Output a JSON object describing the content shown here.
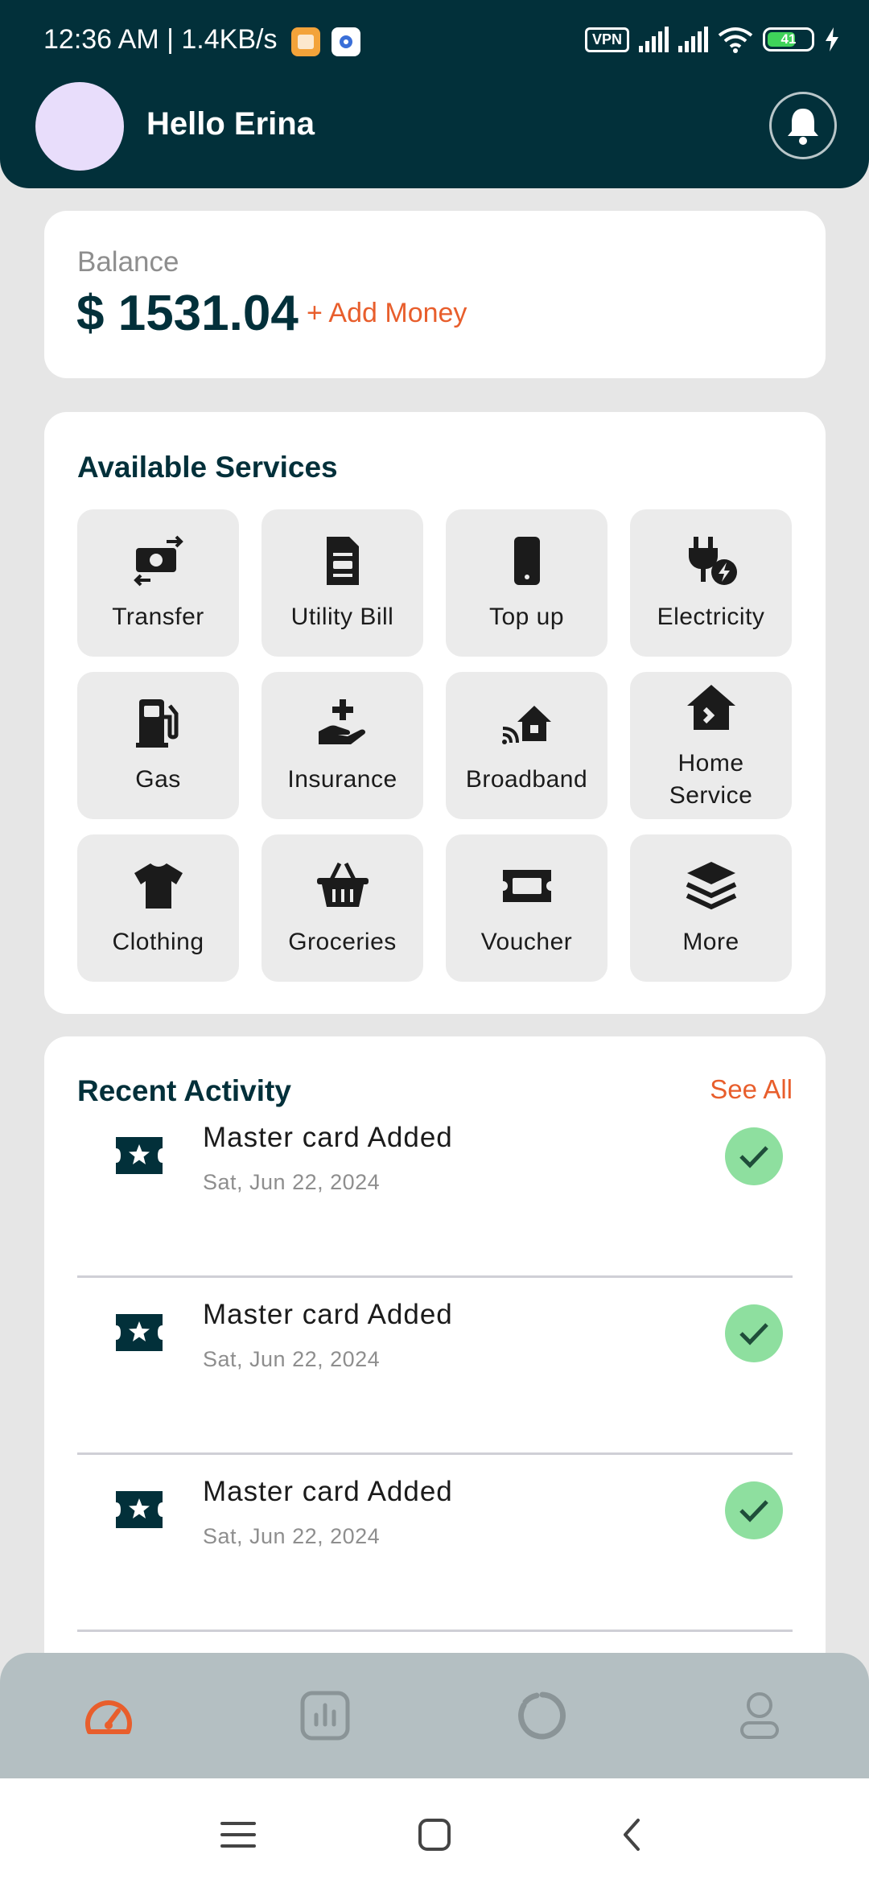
{
  "status_bar": {
    "time": "12:36 AM | 1.4KB/s",
    "vpn": "VPN",
    "battery": "41"
  },
  "header": {
    "greeting": "Hello Erina"
  },
  "balance": {
    "label": "Balance",
    "amount": "$ 1531.04",
    "add_money": "+ Add Money"
  },
  "services": {
    "title": "Available Services",
    "items": [
      {
        "label": "Transfer",
        "icon": "money-transfer-icon"
      },
      {
        "label": "Utility Bill",
        "icon": "bill-icon"
      },
      {
        "label": "Top up",
        "icon": "phone-icon"
      },
      {
        "label": "Electricity",
        "icon": "plug-bolt-icon"
      },
      {
        "label": "Gas",
        "icon": "gas-pump-icon"
      },
      {
        "label": "Insurance",
        "icon": "hand-plus-icon"
      },
      {
        "label": "Broadband",
        "icon": "house-signal-icon"
      },
      {
        "label": "Home Service",
        "icon": "home-icon"
      },
      {
        "label": "Clothing",
        "icon": "shirt-icon"
      },
      {
        "label": "Groceries",
        "icon": "basket-icon"
      },
      {
        "label": "Voucher",
        "icon": "ticket-icon"
      },
      {
        "label": "More",
        "icon": "layers-icon"
      }
    ]
  },
  "activity": {
    "title": "Recent Activity",
    "see_all": "See All",
    "items": [
      {
        "title": "Master card Added",
        "date": "Sat, Jun 22, 2024"
      },
      {
        "title": "Master card Added",
        "date": "Sat, Jun 22, 2024"
      },
      {
        "title": "Master card Added",
        "date": "Sat, Jun 22, 2024"
      }
    ]
  },
  "bottom_nav": {
    "items": [
      "dashboard-icon",
      "analytics-icon",
      "progress-icon",
      "profile-icon"
    ],
    "active_color": "#e85e2c",
    "inactive_color": "#8a9497"
  },
  "colors": {
    "primary": "#02303a",
    "accent": "#e85e2c",
    "success": "#8edf9f"
  }
}
